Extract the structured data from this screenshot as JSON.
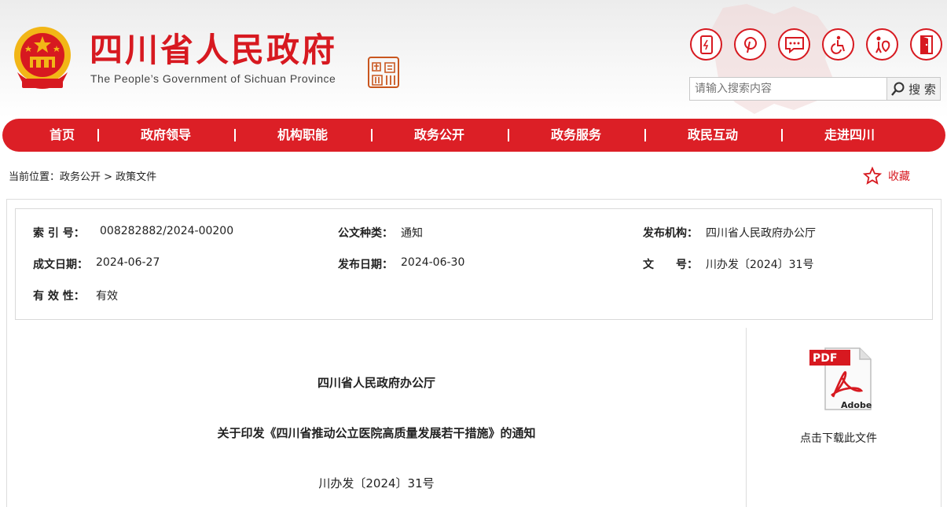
{
  "header": {
    "title": "四川省人民政府",
    "subtitle": "The People’s Government of Sichuan Province",
    "seal_chars": [
      "中",
      "國",
      "四",
      "川"
    ],
    "tools": [
      {
        "name": "mobile-icon"
      },
      {
        "name": "weibo-icon"
      },
      {
        "name": "message-icon"
      },
      {
        "name": "accessibility-icon"
      },
      {
        "name": "elderly-mode-icon"
      },
      {
        "name": "exit-icon"
      }
    ],
    "search": {
      "placeholder": "请输入搜索内容",
      "button_label": "搜 索"
    }
  },
  "nav": {
    "items": [
      "首页",
      "政府领导",
      "机构职能",
      "政务公开",
      "政务服务",
      "政民互动",
      "走进四川"
    ]
  },
  "breadcrumb": {
    "text": "当前位置：政务公开 > 政策文件"
  },
  "favorite": {
    "label": "收藏"
  },
  "meta": {
    "index_label": "索 引 号：",
    "index_value": "008282882/2024-00200",
    "type_label": "公文种类：",
    "type_value": "通知",
    "agency_label": "发布机构：",
    "agency_value": "四川省人民政府办公厅",
    "written_label": "成文日期：",
    "written_value": "2024-06-27",
    "published_label": "发布日期：",
    "published_value": "2024-06-30",
    "docno_label": "文　　号：",
    "docno_value": "川办发〔2024〕31号",
    "validity_label": "有 效 性：",
    "validity_value": "有效"
  },
  "document": {
    "issuer": "四川省人民政府办公厅",
    "title": "关于印发《四川省推动公立医院高质量发展若干措施》的通知",
    "number": "川办发〔2024〕31号"
  },
  "download": {
    "label": "点击下载此文件",
    "pdf_text": "PDF",
    "adobe_text": "Adobe"
  },
  "colors": {
    "brand_red": "#dc1f26",
    "seal_orange": "#c9561e"
  }
}
